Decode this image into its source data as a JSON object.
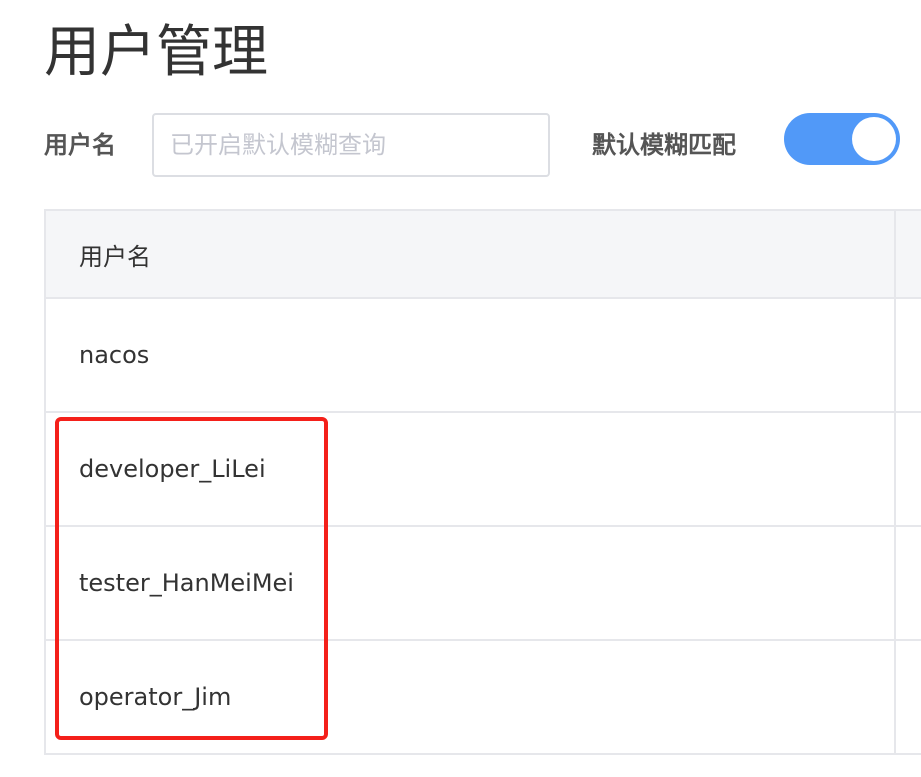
{
  "page": {
    "title": "用户管理"
  },
  "filter": {
    "username_label": "用户名",
    "search_placeholder": "已开启默认模糊查询",
    "search_value": "",
    "fuzzy_label": "默认模糊匹配",
    "fuzzy_enabled": true
  },
  "table": {
    "header": {
      "username": "用户名"
    },
    "rows": [
      {
        "username": "nacos"
      },
      {
        "username": "developer_LiLei"
      },
      {
        "username": "tester_HanMeiMei"
      },
      {
        "username": "operator_Jim"
      }
    ]
  },
  "colors": {
    "toggle_on": "#5199f8",
    "highlight": "#f4201a",
    "header_bg": "#f5f6f8",
    "border": "#e6e7eb"
  }
}
